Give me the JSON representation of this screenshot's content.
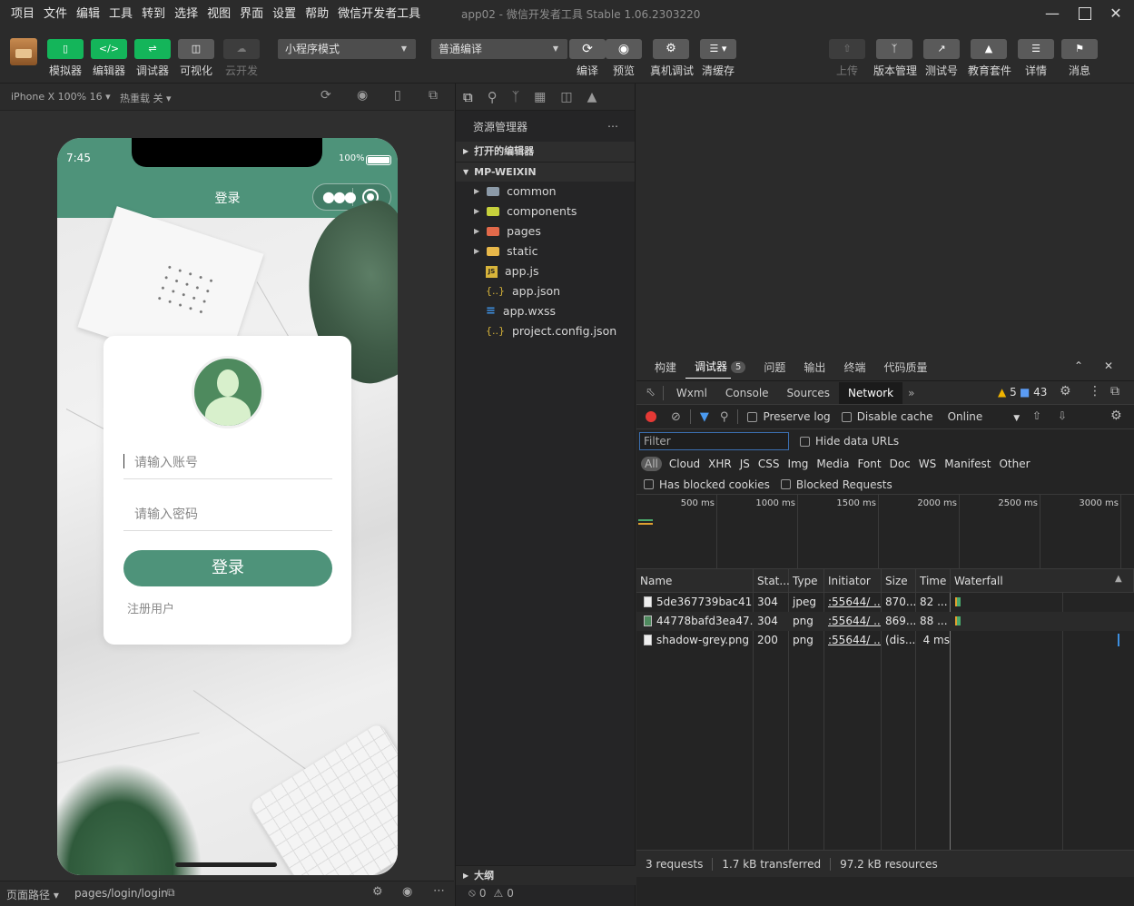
{
  "menu": [
    "项目",
    "文件",
    "编辑",
    "工具",
    "转到",
    "选择",
    "视图",
    "界面",
    "设置",
    "帮助",
    "微信开发者工具"
  ],
  "window_title": "app02 - 微信开发者工具 Stable 1.06.2303220",
  "toolbar": {
    "left_buttons": [
      {
        "label": "模拟器",
        "icon": "phone-icon",
        "style": "green"
      },
      {
        "label": "编辑器",
        "icon": "code-icon",
        "style": "green"
      },
      {
        "label": "调试器",
        "icon": "debugger-icon",
        "style": "green"
      },
      {
        "label": "可视化",
        "icon": "layout-icon",
        "style": "gray"
      },
      {
        "label": "云开发",
        "icon": "cloud-icon",
        "style": "dim"
      }
    ],
    "mode_select": "小程序模式",
    "compile_select": "普通编译",
    "mid_buttons": [
      {
        "label": "编译",
        "icon": "refresh-icon"
      },
      {
        "label": "预览",
        "icon": "eye-icon"
      },
      {
        "label": "真机调试",
        "icon": "bug-icon"
      },
      {
        "label": "清缓存",
        "icon": "layers-icon"
      }
    ],
    "right_buttons": [
      {
        "label": "上传",
        "icon": "upload-icon",
        "dim": true
      },
      {
        "label": "版本管理",
        "icon": "branch-icon",
        "dim": false
      },
      {
        "label": "测试号",
        "icon": "external-icon",
        "dim": false
      },
      {
        "label": "教育套件",
        "icon": "graduation-icon",
        "dim": false
      },
      {
        "label": "详情",
        "icon": "menu-icon",
        "dim": false
      },
      {
        "label": "消息",
        "icon": "bell-icon",
        "dim": false
      }
    ]
  },
  "simulator": {
    "device": "iPhone X 100% 16",
    "hot_reload": "热重载 关",
    "status_time": "7:45",
    "battery": "100%",
    "nav_title": "登录",
    "account_placeholder": "请输入账号",
    "password_placeholder": "请输入密码",
    "login_button": "登录",
    "register_link": "注册用户",
    "page_path_label": "页面路径",
    "page_path": "pages/login/login"
  },
  "explorer": {
    "title": "资源管理器",
    "open_editors": "打开的编辑器",
    "project": "MP-WEIXIN",
    "items": [
      {
        "name": "common",
        "type": "folder",
        "color": "#8c9aa8"
      },
      {
        "name": "components",
        "type": "folder",
        "color": "#c7d13c"
      },
      {
        "name": "pages",
        "type": "folder",
        "color": "#e2694a"
      },
      {
        "name": "static",
        "type": "folder",
        "color": "#e8b84a"
      },
      {
        "name": "app.js",
        "type": "js"
      },
      {
        "name": "app.json",
        "type": "json"
      },
      {
        "name": "app.wxss",
        "type": "wxss"
      },
      {
        "name": "project.config.json",
        "type": "json"
      }
    ],
    "outline": "大纲",
    "errors": "0",
    "warnings": "0"
  },
  "devtools": {
    "top_tabs": [
      "构建",
      "调试器",
      "问题",
      "输出",
      "终端",
      "代码质量"
    ],
    "debugger_badge": "5",
    "panel_tabs": [
      "Wxml",
      "Console",
      "Sources",
      "Network"
    ],
    "active_panel": "Network",
    "warn_count": "5",
    "msg_count": "43",
    "preserve_log": "Preserve log",
    "disable_cache": "Disable cache",
    "throttle": "Online",
    "filter_placeholder": "Filter",
    "hide_data_urls": "Hide data URLs",
    "type_filters": [
      "All",
      "Cloud",
      "XHR",
      "JS",
      "CSS",
      "Img",
      "Media",
      "Font",
      "Doc",
      "WS",
      "Manifest",
      "Other"
    ],
    "has_blocked_cookies": "Has blocked cookies",
    "blocked_requests": "Blocked Requests",
    "timeline_ticks": [
      "500 ms",
      "1000 ms",
      "1500 ms",
      "2000 ms",
      "2500 ms",
      "3000 ms"
    ],
    "columns": [
      "Name",
      "Stat...",
      "Type",
      "Initiator",
      "Size",
      "Time",
      "Waterfall"
    ],
    "rows": [
      {
        "name": "5de367739bac41...",
        "status": "304",
        "type": "jpeg",
        "initiator": ":55644/ ...",
        "size": "870...",
        "time": "82 ..."
      },
      {
        "name": "44778bafd3ea47...",
        "status": "304",
        "type": "png",
        "initiator": ":55644/ ...",
        "size": "869...",
        "time": "88 ..."
      },
      {
        "name": "shadow-grey.png",
        "status": "200",
        "type": "png",
        "initiator": ":55644/ ...",
        "size": "(dis...",
        "time": "4 ms"
      }
    ],
    "summary_requests": "3 requests",
    "summary_transferred": "1.7 kB transferred",
    "summary_resources": "97.2 kB resources"
  },
  "colors": {
    "brand_green": "#14b55a",
    "theme_green": "#4e937a",
    "record_red": "#e53935"
  }
}
